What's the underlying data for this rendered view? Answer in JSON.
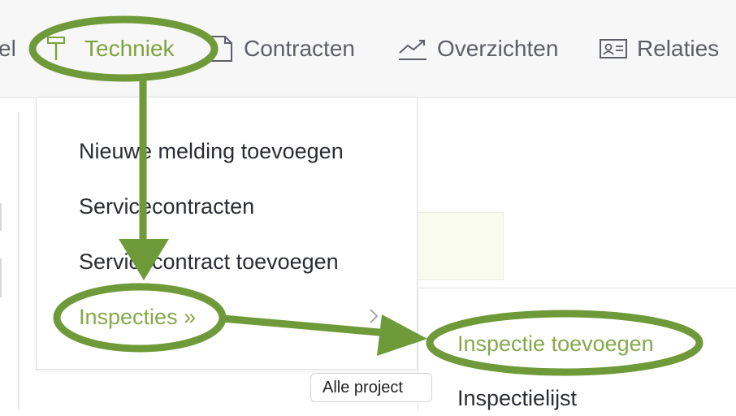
{
  "nav": {
    "partial_left": "el",
    "techniek": "Techniek",
    "contracten": "Contracten",
    "overzichten": "Overzichten",
    "relaties": "Relaties"
  },
  "dropdown": {
    "items": [
      "Nieuwe melding toevoegen",
      "Servicecontracten",
      "Servicecontract toevoegen",
      "Inspecties »"
    ]
  },
  "submenu": {
    "items": [
      "Inspectie toevoegen",
      "Inspectielijst"
    ]
  },
  "button": {
    "alle_projecten": "Alle project"
  },
  "colors": {
    "accent_green": "#86a84b",
    "annotation_green": "#6f9a3a",
    "text_dark": "#2b2d33",
    "nav_gray": "#5d5f66"
  },
  "icons": {
    "techniek": "hammer-icon",
    "contracten": "document-icon",
    "overzichten": "chart-trend-icon",
    "relaties": "contact-card-icon",
    "submenu_indicator": "chevron-right-icon"
  }
}
